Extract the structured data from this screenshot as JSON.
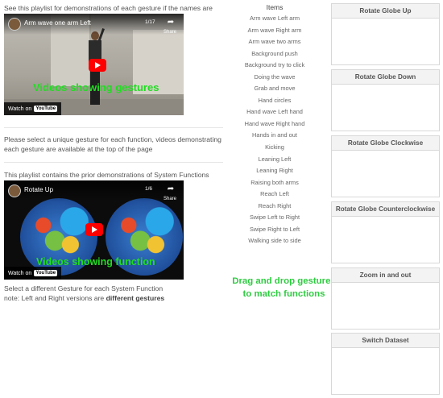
{
  "intro_text": "See this playlist for demonstrations of each gesture if the names are unclear.",
  "video1": {
    "title": "Arm wave one arm Left",
    "counter": "1/17",
    "share_label": "Share",
    "overlay_text": "Videos showing gestures",
    "watch_on": "Watch on",
    "youtube_label": "YouTube"
  },
  "instructions_text": "Please select a unique gesture for each function, videos demonstrating each gesture are available at the top of the page",
  "system_functions_text": "This playlist contains the prior demonstrations of System Functions",
  "video2": {
    "title": "Rotate Up",
    "counter": "1/6",
    "share_label": "Share",
    "overlay_text": "Videos showing function",
    "watch_on": "Watch on",
    "youtube_label": "YouTube"
  },
  "note": {
    "line1": "Select a different Gesture for each System Function",
    "line2_prefix": "note: Left and Right versions are ",
    "line2_bold": "different gestures"
  },
  "items": {
    "title": "Items",
    "list": [
      "Arm wave Left arm",
      "Arm wave Right arm",
      "Arm wave two arms",
      "Background push",
      "Background try to click",
      "Doing the wave",
      "Grab and move",
      "Hand circles",
      "Hand wave Left hand",
      "Hand wave Right hand",
      "Hands in and out",
      "Kicking",
      "Leaning Left",
      "Leaning Right",
      "Raising both arms",
      "Reach Left",
      "Reach Right",
      "Swipe Left to Right",
      "Swipe Right to Left",
      "Walking side to side"
    ]
  },
  "drag_hint": {
    "line1": "Drag and drop gestures",
    "line2": "to match functions"
  },
  "functions": [
    "Rotate Globe Up",
    "Rotate Globe Down",
    "Rotate Globe Clockwise",
    "Rotate Globe Counterclockwise",
    "Zoom in and out",
    "Switch Dataset"
  ],
  "colors": {
    "hint_green": "#2ecc40",
    "overlay_green": "#22dd22",
    "youtube_red": "#ff0000"
  }
}
